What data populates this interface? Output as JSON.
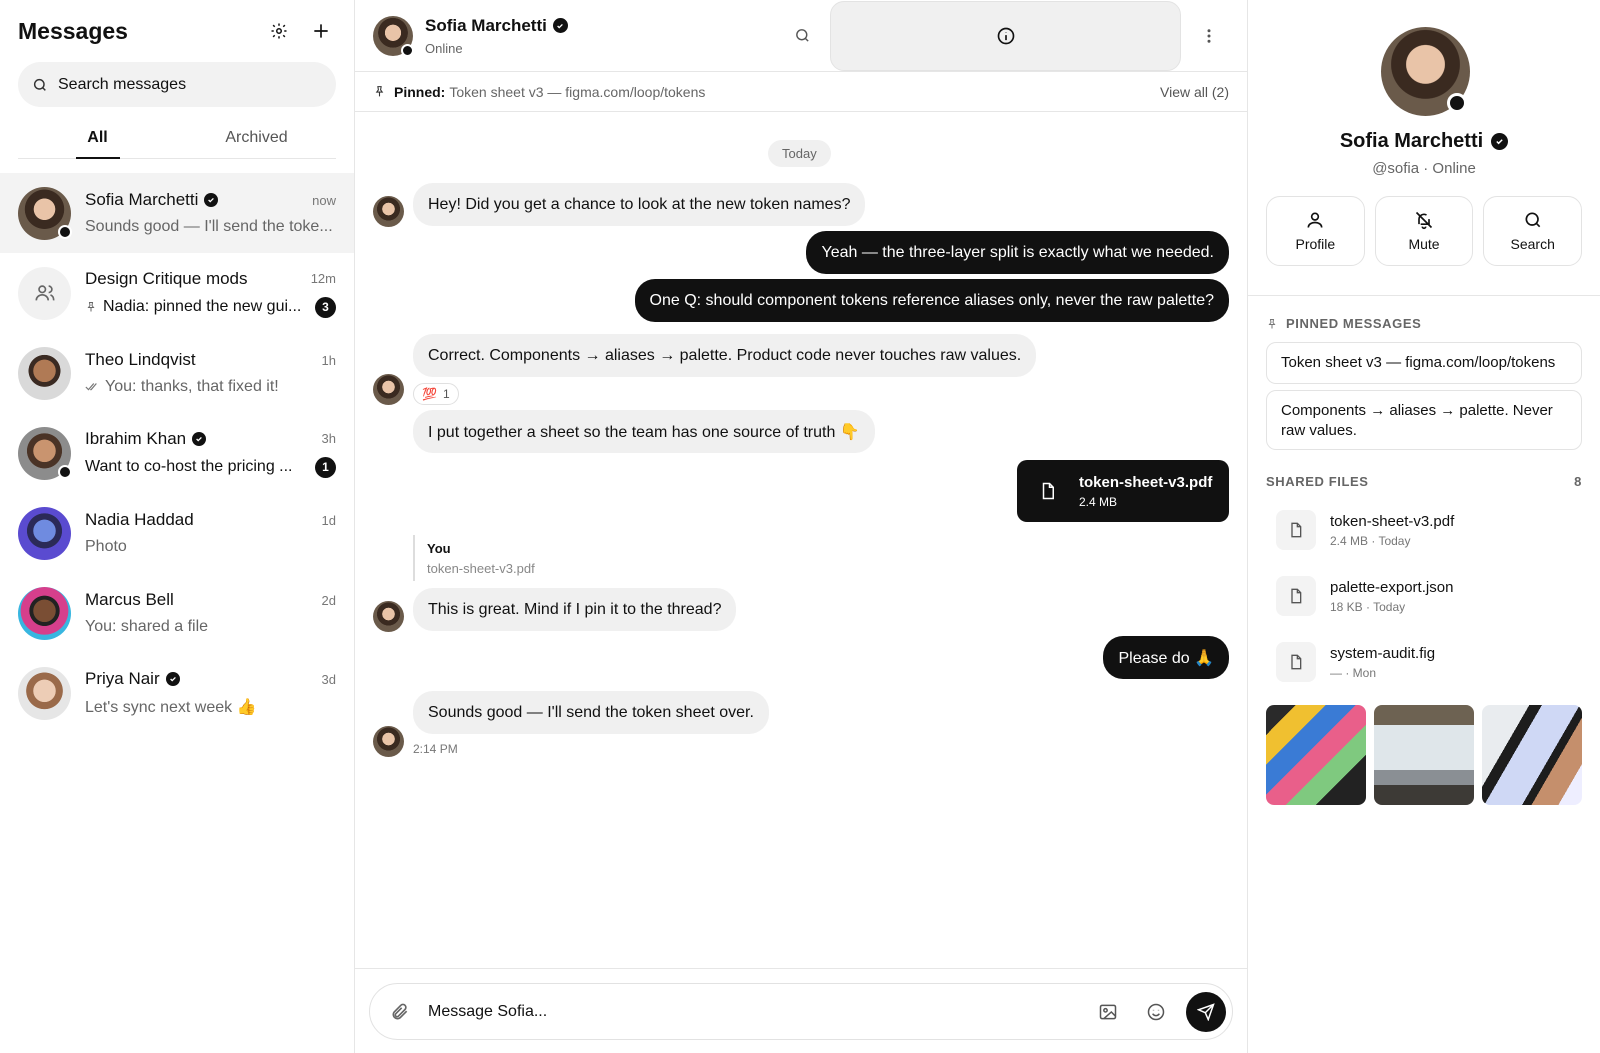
{
  "sidebar": {
    "title": "Messages",
    "search_placeholder": "Search messages",
    "tabs": [
      "All",
      "Archived"
    ],
    "conversations": [
      {
        "name": "Sofia Marchetti",
        "time": "now",
        "preview": "Sounds good — I'll send the toke...",
        "verified": true,
        "online": true,
        "selected": true
      },
      {
        "name": "Design Critique mods",
        "time": "12m",
        "preview": "Nadia: pinned the new gui...",
        "badge": "3",
        "group": true
      },
      {
        "name": "Theo Lindqvist",
        "time": "1h",
        "preview": "You: thanks, that fixed it!"
      },
      {
        "name": "Ibrahim Khan",
        "time": "3h",
        "preview": "Want to co-host the pricing ...",
        "verified": true,
        "online": true,
        "badge": "1"
      },
      {
        "name": "Nadia Haddad",
        "time": "1d",
        "preview": "Photo"
      },
      {
        "name": "Marcus Bell",
        "time": "2d",
        "preview": "You: shared a file"
      },
      {
        "name": "Priya Nair",
        "time": "3d",
        "preview": "Let's sync next week 👍",
        "verified": true
      }
    ]
  },
  "chat": {
    "name": "Sofia Marchetti",
    "status": "Online",
    "pinned_label": "Pinned:",
    "pinned_text": "Token sheet v3 — figma.com/loop/tokens",
    "view_all": "View all (2)",
    "date_divider": "Today",
    "messages": [
      {
        "dir": "in",
        "text": "Hey! Did you get a chance to look at the new token names?"
      },
      {
        "dir": "out",
        "text": "Yeah — the three-layer split is exactly what we needed."
      },
      {
        "dir": "out",
        "text": "One Q: should component tokens reference aliases only, never the raw palette?"
      },
      {
        "dir": "in",
        "text": "Correct. Components → aliases → palette. Product code never touches raw values."
      },
      {
        "dir": "in",
        "text": "I put together a sheet so the team has one source of truth 👇"
      },
      {
        "dir": "in",
        "text": "This is great. Mind if I pin it to the thread?"
      },
      {
        "dir": "out",
        "text": "Please do 🙏"
      },
      {
        "dir": "in",
        "text": "Sounds good — I'll send the token sheet over."
      }
    ],
    "reaction": {
      "emoji": "💯",
      "count": "1"
    },
    "file": {
      "name": "token-sheet-v3.pdf",
      "size": "2.4 MB"
    },
    "quote": {
      "author": "You",
      "text": "token-sheet-v3.pdf"
    },
    "last_time": "2:14 PM",
    "composer_placeholder": "Message Sofia..."
  },
  "profile": {
    "name": "Sofia Marchetti",
    "handle": "@sofia · Online",
    "actions": [
      "Profile",
      "Mute",
      "Search"
    ],
    "pinned_title": "PINNED MESSAGES",
    "pinned": [
      "Token sheet v3 — figma.com/loop/tokens",
      "Components → aliases → palette. Never raw values."
    ],
    "files_title": "SHARED FILES",
    "files_count": "8",
    "files": [
      {
        "name": "token-sheet-v3.pdf",
        "meta": "2.4 MB · Today"
      },
      {
        "name": "palette-export.json",
        "meta": "18 KB · Today"
      },
      {
        "name": "system-audit.fig",
        "meta": "— · Mon"
      }
    ]
  },
  "colors": {
    "accent": "#111111",
    "bubble_in": "#f0f0f0",
    "muted": "#666666"
  }
}
